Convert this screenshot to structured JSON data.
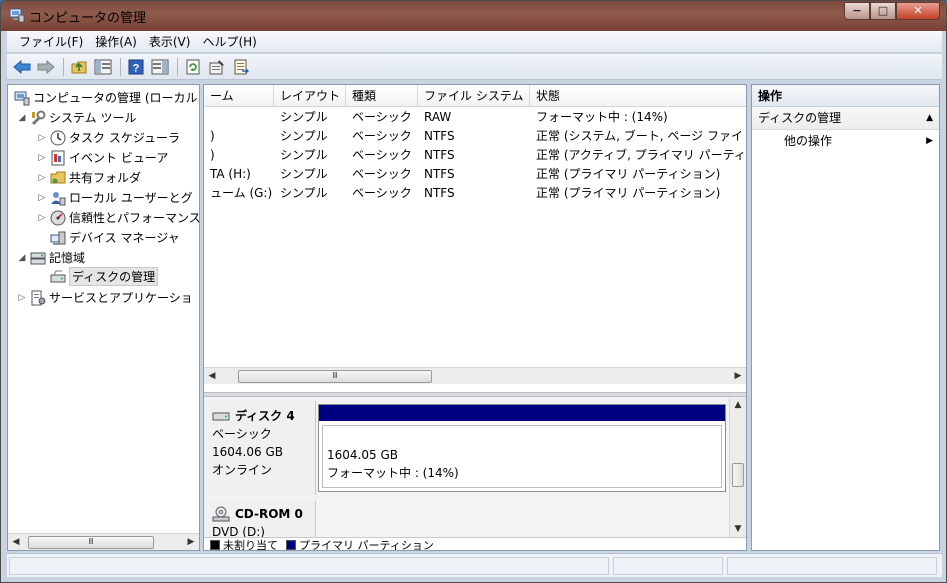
{
  "window": {
    "title": "コンピュータの管理",
    "icon": "computer-management-icon"
  },
  "caption_buttons": {
    "minimize": "−",
    "maximize": "□",
    "close": "✕"
  },
  "menu": [
    "ファイル(F)",
    "操作(A)",
    "表示(V)",
    "ヘルプ(H)"
  ],
  "toolbar": [
    "back-icon",
    "forward-icon",
    "up-folder-icon",
    "show-hide-tree-icon",
    "help-icon",
    "show-hide-action-icon",
    "refresh-icon",
    "properties-icon",
    "export-list-icon"
  ],
  "tree": {
    "root": "コンピュータの管理 (ローカル",
    "system_tools": "システム ツール",
    "task_scheduler": "タスク スケジューラ",
    "event_viewer": "イベント ビューア",
    "shared_folders": "共有フォルダ",
    "local_users": "ローカル ユーザーとグ",
    "reliability": "信頼性とパフォーマンス",
    "device_manager": "デバイス マネージャ",
    "storage": "記憶域",
    "disk_management": "ディスクの管理",
    "services": "サービスとアプリケーショ",
    "scroll_thumb": "Ⅲ"
  },
  "volume_list": {
    "columns": [
      "ーム",
      "レイアウト",
      "種類",
      "ファイル システム",
      "状態"
    ],
    "rows": [
      {
        "volume": "",
        "layout": "シンプル",
        "type": "ベーシック",
        "fs": "RAW",
        "status": "フォーマット中 : (14%)"
      },
      {
        "volume": ")",
        "layout": "シンプル",
        "type": "ベーシック",
        "fs": "NTFS",
        "status": "正常 (システム, ブート, ページ ファイ"
      },
      {
        "volume": ")",
        "layout": "シンプル",
        "type": "ベーシック",
        "fs": "NTFS",
        "status": "正常 (アクティブ, プライマリ パーティ"
      },
      {
        "volume": "TA (H:)",
        "layout": "シンプル",
        "type": "ベーシック",
        "fs": "NTFS",
        "status": "正常 (プライマリ パーティション)"
      },
      {
        "volume": "ューム (G:)",
        "layout": "シンプル",
        "type": "ベーシック",
        "fs": "NTFS",
        "status": "正常 (プライマリ パーティション)"
      }
    ],
    "scroll_thumb": "Ⅲ"
  },
  "disks": {
    "disk4": {
      "name": "ディスク 4",
      "kind": "ベーシック",
      "size": "1604.06 GB",
      "state": "オンライン",
      "partition_size": "1604.05 GB",
      "partition_status": "フォーマット中 : (14%)",
      "partition_color": "#000080"
    },
    "cdrom0": {
      "name": "CD-ROM 0",
      "kind": "DVD (D:)"
    }
  },
  "legend": {
    "unallocated": "未割り当て",
    "unallocated_color": "#000000",
    "primary": "プライマリ パーティション",
    "primary_color": "#000080"
  },
  "actions": {
    "header": "操作",
    "section": "ディスクの管理",
    "section_arrow": "▲",
    "more": "他の操作",
    "more_arrow": "▶"
  }
}
